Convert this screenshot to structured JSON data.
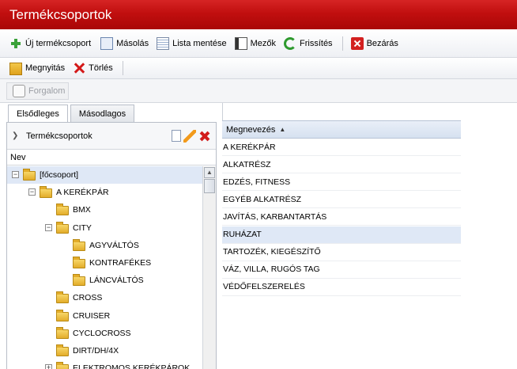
{
  "window": {
    "title": "Termékcsoportok"
  },
  "toolbar1": [
    {
      "label": "Új termékcsoport",
      "icon": "plus-icon"
    },
    {
      "label": "Másolás",
      "icon": "copy-icon"
    },
    {
      "label": "Lista mentése",
      "icon": "list-icon"
    },
    {
      "label": "Mezők",
      "icon": "fields-icon"
    },
    {
      "label": "Frissítés",
      "icon": "refresh-icon"
    },
    {
      "label": "Bezárás",
      "icon": "close-icon"
    }
  ],
  "toolbar2": [
    {
      "label": "Megnyitás",
      "icon": "folder-open-icon"
    },
    {
      "label": "Törlés",
      "icon": "delete-icon"
    }
  ],
  "toolbar3": {
    "label": "Forgalom",
    "icon": "hand-icon",
    "disabled": true
  },
  "tabs": [
    {
      "label": "Elsődleges",
      "active": true
    },
    {
      "label": "Másodlagos",
      "active": false
    }
  ],
  "tree_panel": {
    "header": "Termékcsoportok",
    "column": "Nev",
    "items": [
      {
        "label": "[főcsoport]",
        "level": 0,
        "expanded": true,
        "selected": true
      },
      {
        "label": "A KERÉKPÁR",
        "level": 1,
        "expanded": true
      },
      {
        "label": "BMX",
        "level": 2
      },
      {
        "label": "CITY",
        "level": 2,
        "expanded": true
      },
      {
        "label": "AGYVÁLTÓS",
        "level": 3
      },
      {
        "label": "KONTRAFÉKES",
        "level": 3
      },
      {
        "label": "LÁNCVÁLTÓS",
        "level": 3
      },
      {
        "label": "CROSS",
        "level": 2
      },
      {
        "label": "CRUISER",
        "level": 2
      },
      {
        "label": "CYCLOCROSS",
        "level": 2
      },
      {
        "label": "DIRT/DH/4X",
        "level": 2
      },
      {
        "label": "ELEKTROMOS KERÉKPÁROK",
        "level": 2,
        "expanded": false
      }
    ]
  },
  "grid": {
    "column": "Megnevezés",
    "sort": "asc",
    "rows": [
      {
        "name": "A KERÉKPÁR"
      },
      {
        "name": "ALKATRÉSZ"
      },
      {
        "name": "EDZÉS, FITNESS"
      },
      {
        "name": "EGYÉB ALKATRÉSZ"
      },
      {
        "name": "JAVÍTÁS, KARBANTARTÁS"
      },
      {
        "name": "RUHÁZAT",
        "selected": true
      },
      {
        "name": "TARTOZÉK, KIEGÉSZÍTŐ"
      },
      {
        "name": "VÁZ, VILLA, RUGÓS TAG"
      },
      {
        "name": "VÉDŐFELSZERELÉS"
      }
    ]
  },
  "colors": {
    "titlebar": "#c10f0f",
    "selection": "#dfe8f6",
    "grid_header": "#d6e1f0"
  }
}
